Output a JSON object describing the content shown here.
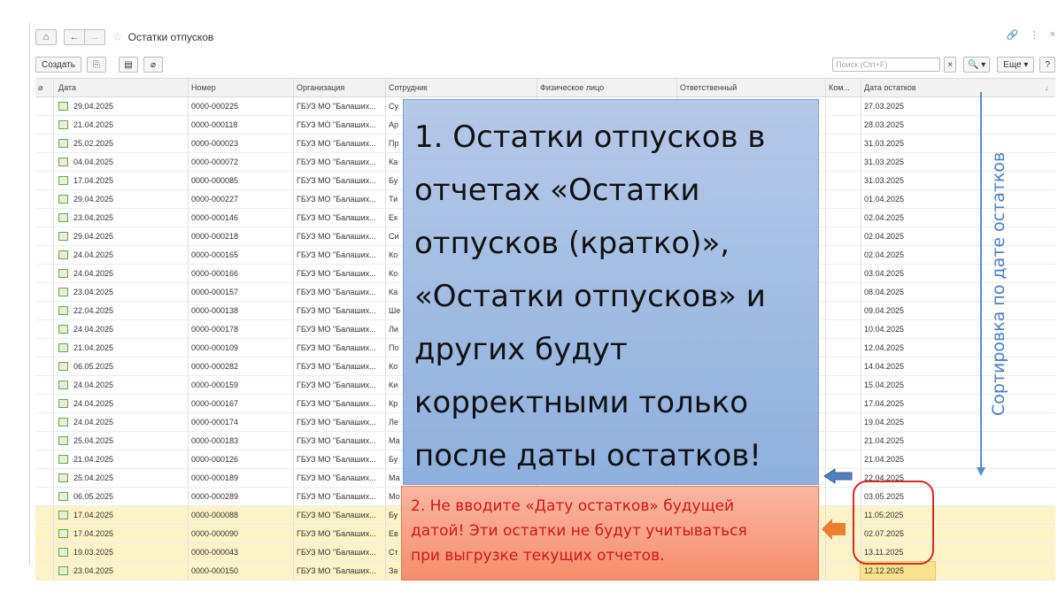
{
  "window": {
    "title": "Остатки отпусков",
    "home_icon": "home-icon",
    "back_icon": "arrow-left-icon",
    "forward_icon": "arrow-right-icon",
    "star_icon": "star-icon",
    "link_icon": "link-icon",
    "more_icon": "more-vertical-icon",
    "close_icon": "close-icon"
  },
  "toolbar": {
    "create_label": "Создать",
    "search_placeholder": "Поиск (Ctrl+F)",
    "clear_label": "×",
    "search_btn_label": "🔍 ▾",
    "more_label": "Еще ▾",
    "help_label": "?"
  },
  "table": {
    "columns": [
      "Дата",
      "Номер",
      "Организация",
      "Сотрудник",
      "Физическое лицо",
      "Ответственный",
      "Ком...",
      "Дата остатков"
    ],
    "sort_indicator": "↓",
    "rows": [
      {
        "date": "29.04.2025",
        "num": "0000-000225",
        "org": "ГБУЗ МО \"Балаших...",
        "emp": "Су",
        "rest": "27.03.2025"
      },
      {
        "date": "21.04.2025",
        "num": "0000-000118",
        "org": "ГБУЗ МО \"Балаших...",
        "emp": "Ар",
        "rest": "28.03.2025"
      },
      {
        "date": "25.02.2025",
        "num": "0000-000023",
        "org": "ГБУЗ МО \"Балаших...",
        "emp": "Пр",
        "rest": "31.03.2025"
      },
      {
        "date": "04.04.2025",
        "num": "0000-000072",
        "org": "ГБУЗ МО \"Балаших...",
        "emp": "Ка",
        "rest": "31.03.2025"
      },
      {
        "date": "17.04.2025",
        "num": "0000-000085",
        "org": "ГБУЗ МО \"Балаших...",
        "emp": "Бу",
        "rest": "31.03.2025"
      },
      {
        "date": "29.04.2025",
        "num": "0000-000227",
        "org": "ГБУЗ МО \"Балаших...",
        "emp": "Ти",
        "rest": "01.04.2025"
      },
      {
        "date": "23.04.2025",
        "num": "0000-000146",
        "org": "ГБУЗ МО \"Балаших...",
        "emp": "Ек",
        "rest": "02.04.2025"
      },
      {
        "date": "29.04.2025",
        "num": "0000-000218",
        "org": "ГБУЗ МО \"Балаших...",
        "emp": "Си",
        "rest": "02.04.2025"
      },
      {
        "date": "24.04.2025",
        "num": "0000-000165",
        "org": "ГБУЗ МО \"Балаших...",
        "emp": "Ко",
        "rest": "02.04.2025"
      },
      {
        "date": "24.04.2025",
        "num": "0000-000166",
        "org": "ГБУЗ МО \"Балаших...",
        "emp": "Ко",
        "rest": "03.04.2025"
      },
      {
        "date": "23.04.2025",
        "num": "0000-000157",
        "org": "ГБУЗ МО \"Балаших...",
        "emp": "Ка",
        "rest": "08.04.2025"
      },
      {
        "date": "22.04.2025",
        "num": "0000-000138",
        "org": "ГБУЗ МО \"Балаших...",
        "emp": "Ше",
        "rest": "09.04.2025"
      },
      {
        "date": "24.04.2025",
        "num": "0000-000178",
        "org": "ГБУЗ МО \"Балаших...",
        "emp": "Ли",
        "rest": "10.04.2025"
      },
      {
        "date": "21.04.2025",
        "num": "0000-000109",
        "org": "ГБУЗ МО \"Балаших...",
        "emp": "По",
        "rest": "12.04.2025"
      },
      {
        "date": "06.05.2025",
        "num": "0000-000282",
        "org": "ГБУЗ МО \"Балаших...",
        "emp": "Ко",
        "rest": "14.04.2025"
      },
      {
        "date": "24.04.2025",
        "num": "0000-000159",
        "org": "ГБУЗ МО \"Балаших...",
        "emp": "Ки",
        "rest": "15.04.2025"
      },
      {
        "date": "24.04.2025",
        "num": "0000-000167",
        "org": "ГБУЗ МО \"Балаших...",
        "emp": "Кр",
        "rest": "17.04.2025"
      },
      {
        "date": "24.04.2025",
        "num": "0000-000174",
        "org": "ГБУЗ МО \"Балаших...",
        "emp": "Ле",
        "rest": "19.04.2025"
      },
      {
        "date": "25.04.2025",
        "num": "0000-000183",
        "org": "ГБУЗ МО \"Балаших...",
        "emp": "Ма",
        "rest": "21.04.2025"
      },
      {
        "date": "21.04.2025",
        "num": "0000-000126",
        "org": "ГБУЗ МО \"Балаших...",
        "emp": "Бу",
        "rest": "21.04.2025"
      },
      {
        "date": "25.04.2025",
        "num": "0000-000189",
        "org": "ГБУЗ МО \"Балаших...",
        "emp": "Ма",
        "rest": "22.04.2025"
      },
      {
        "date": "06.05.2025",
        "num": "0000-000289",
        "org": "ГБУЗ МО \"Балаших...",
        "emp": "Мо",
        "rest": "03.05.2025"
      },
      {
        "date": "17.04.2025",
        "num": "0000-000088",
        "org": "ГБУЗ МО \"Балаших...",
        "emp": "Бу",
        "rest": "11.05.2025",
        "future": true
      },
      {
        "date": "17.04.2025",
        "num": "0000-000090",
        "org": "ГБУЗ МО \"Балаших...",
        "emp": "Ев",
        "rest": "02.07.2025",
        "future": true
      },
      {
        "date": "19.03.2025",
        "num": "0000-000043",
        "org": "ГБУЗ МО \"Балаших...",
        "emp": "Ст",
        "rest": "13.11.2025",
        "future": true
      },
      {
        "date": "23.04.2025",
        "num": "0000-000150",
        "org": "ГБУЗ МО \"Балаших...",
        "emp": "За",
        "rest": "12.12.2025",
        "future": true,
        "selected": true
      }
    ]
  },
  "annotations": {
    "main_note": "1. Остатки отпусков в отчетах «Остатки отпусков (кратко)», «Остатки отпусков» и других будут корректными только после даты остатков!",
    "main_note_lines": [
      "1. Остатки отпусков в",
      "отчетах «Остатки",
      "отпусков (кратко)»,",
      "«Остатки отпусков» и",
      "других будут",
      "корректными только",
      "после даты остатков!"
    ],
    "warning_lines": [
      "2. Не вводите «Дату остатков» будущей",
      "датой! Эти остатки не будут учитываться",
      "при выгрузке текущих отчетов."
    ],
    "sort_note": "Сортировка по дате остатков",
    "colors": {
      "blue_box": "#9fbbe3",
      "red_box": "#f7a084",
      "arrow_blue": "#4a7ec2",
      "arrow_orange": "#ec7c30",
      "future_row": "#fdf3c6",
      "circle": "#d62a2a"
    }
  }
}
